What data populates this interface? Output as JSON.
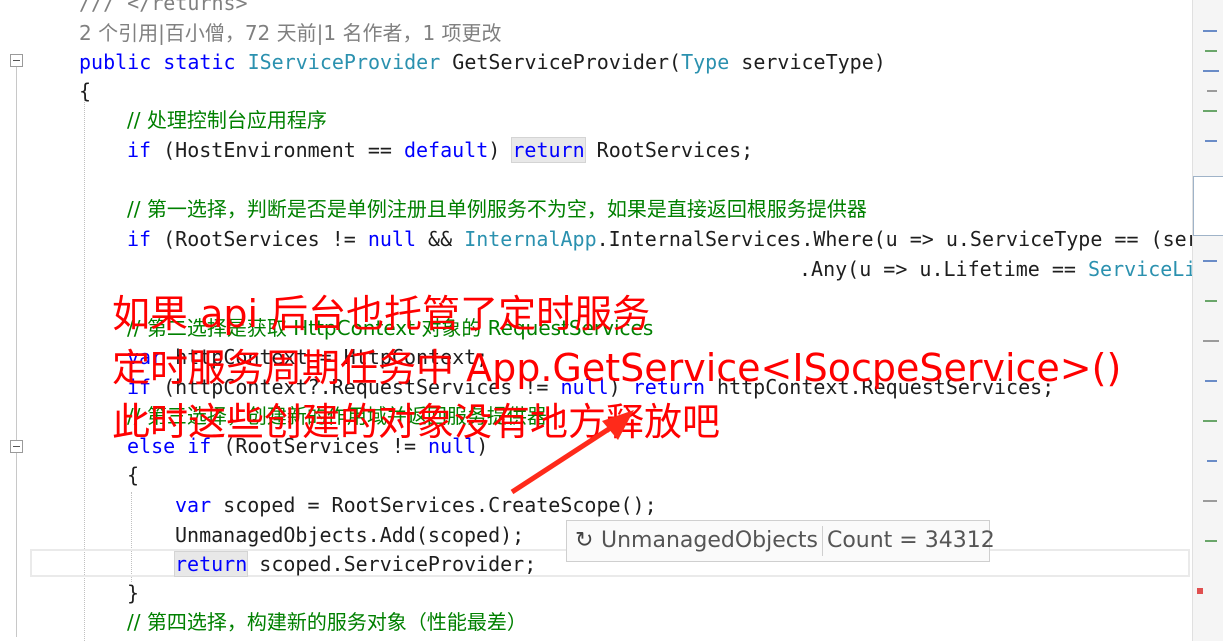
{
  "code": {
    "partial_comment": "/// </returns>",
    "codelens": "2 个引用|百小僧，72 天前|1 名作者，1 项更改",
    "signature": {
      "public": "public",
      "static": "static",
      "return_type": "IServiceProvider",
      "method": " GetServiceProvider(",
      "param_type": "Type",
      "param": " serviceType)"
    },
    "open_brace": "{",
    "c1": "// 处理控制台应用程序",
    "l_if1": {
      "if": "if",
      "a": " (HostEnvironment == ",
      "default": "default",
      "b": ") ",
      "return": "return",
      "c": " RootServices;"
    },
    "c2": "// 第一选择，判断是否是单例注册且单例服务不为空，如果是直接返回根服务提供器",
    "l_if2": {
      "if": "if",
      "a": " (RootServices != ",
      "null": "null",
      "b": " && ",
      "type": "InternalApp",
      "c": ".InternalServices.Where(u => u.ServiceType == (ser"
    },
    "l_any": {
      "a": ".Any(u => u.Lifetime == ",
      "type": "ServiceLi"
    },
    "c3": "// 第二选择是获取 HttpContext 对象的 RequestServices",
    "l_var": {
      "var": "var",
      "a": " httpContext = HttpContext;"
    },
    "l_if3": {
      "if": "if",
      "a": " (httpContext?.RequestServices != ",
      "null": "null",
      "b": ") ",
      "return": "return",
      "c": " httpContext.RequestServices;"
    },
    "c4": "// 第三选择，创建新的作用域并返回服务提供器",
    "l_else": {
      "else": "else",
      "if": " if",
      "a": " (RootServices != ",
      "null": "null",
      "b": ")"
    },
    "inner_open": "{",
    "l_scoped": {
      "var": "var",
      "a": " scoped = RootServices.CreateScope();"
    },
    "l_add": "UnmanagedObjects.Add(scoped);",
    "l_ret": {
      "return": "return",
      "a": " scoped.ServiceProvider;"
    },
    "inner_close": "}",
    "c5": "// 第四选择，构建新的服务对象（性能最差）"
  },
  "annotation": {
    "line1": "如果 api 后台也托管了定时服务",
    "line2": "定时服务周期任务中 App.GetService<ISocpeService>()",
    "line3": "此时这些创建的对象没有地方释放吧"
  },
  "datatip": {
    "icon": "refresh-icon",
    "name": "UnmanagedObjects",
    "value": "Count = 34312"
  },
  "colors": {
    "keyword": "#0000ff",
    "type": "#2b91af",
    "comment": "#008000",
    "annotation": "#ff0000"
  }
}
